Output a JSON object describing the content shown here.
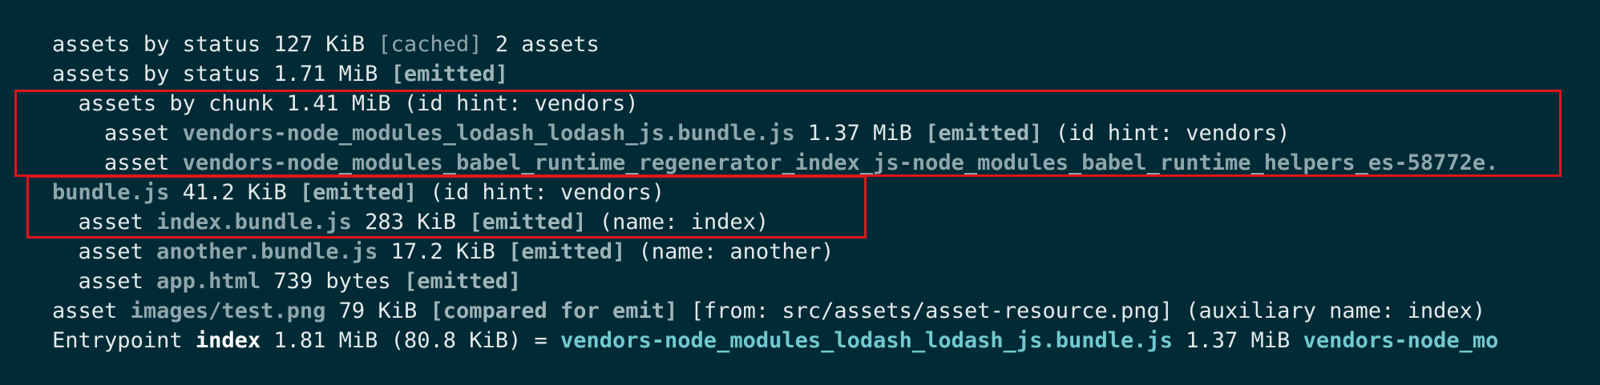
{
  "lines": [
    [
      "assets by status 127 KiB ",
      "[cached]",
      " 2 assets"
    ],
    [
      "assets by status 1.71 MiB ",
      "[emitted]"
    ],
    [
      "  assets by chunk 1.41 MiB (id hint: vendors)"
    ],
    [
      "    asset ",
      "vendors-node_modules_lodash_lodash_js.bundle.js",
      " 1.37 MiB ",
      "[emitted]",
      " (id hint: vendors)"
    ],
    [
      "    asset ",
      "vendors-node_modules_babel_runtime_regenerator_index_js-node_modules_babel_runtime_helpers_es-58772e."
    ],
    [
      "bundle.js",
      " 41.2 KiB ",
      "[emitted]",
      " (id hint: vendors)"
    ],
    [
      "  asset ",
      "index.bundle.js",
      " 283 KiB ",
      "[emitted]",
      " (name: index)"
    ],
    [
      "  asset ",
      "another.bundle.js",
      " 17.2 KiB ",
      "[emitted]",
      " (name: another)"
    ],
    [
      "  asset ",
      "app.html",
      " 739 bytes ",
      "[emitted]"
    ],
    [
      "asset ",
      "images/test.png",
      " 79 KiB ",
      "[compared for emit]",
      " [from: src/assets/asset-resource.png] (auxiliary name: index)"
    ],
    [
      "Entrypoint ",
      "index",
      " 1.81 MiB (80.8 KiB) = ",
      "vendors-node_modules_lodash_lodash_js.bundle.js",
      " 1.37 MiB ",
      "vendors-node_mo"
    ]
  ],
  "colors": {
    "background": "#002b36",
    "text": "#e4e9ea",
    "file_name": "#8fa6ab",
    "entrypoint_file": "#71c9cf",
    "highlight_box": "#e1151b"
  }
}
